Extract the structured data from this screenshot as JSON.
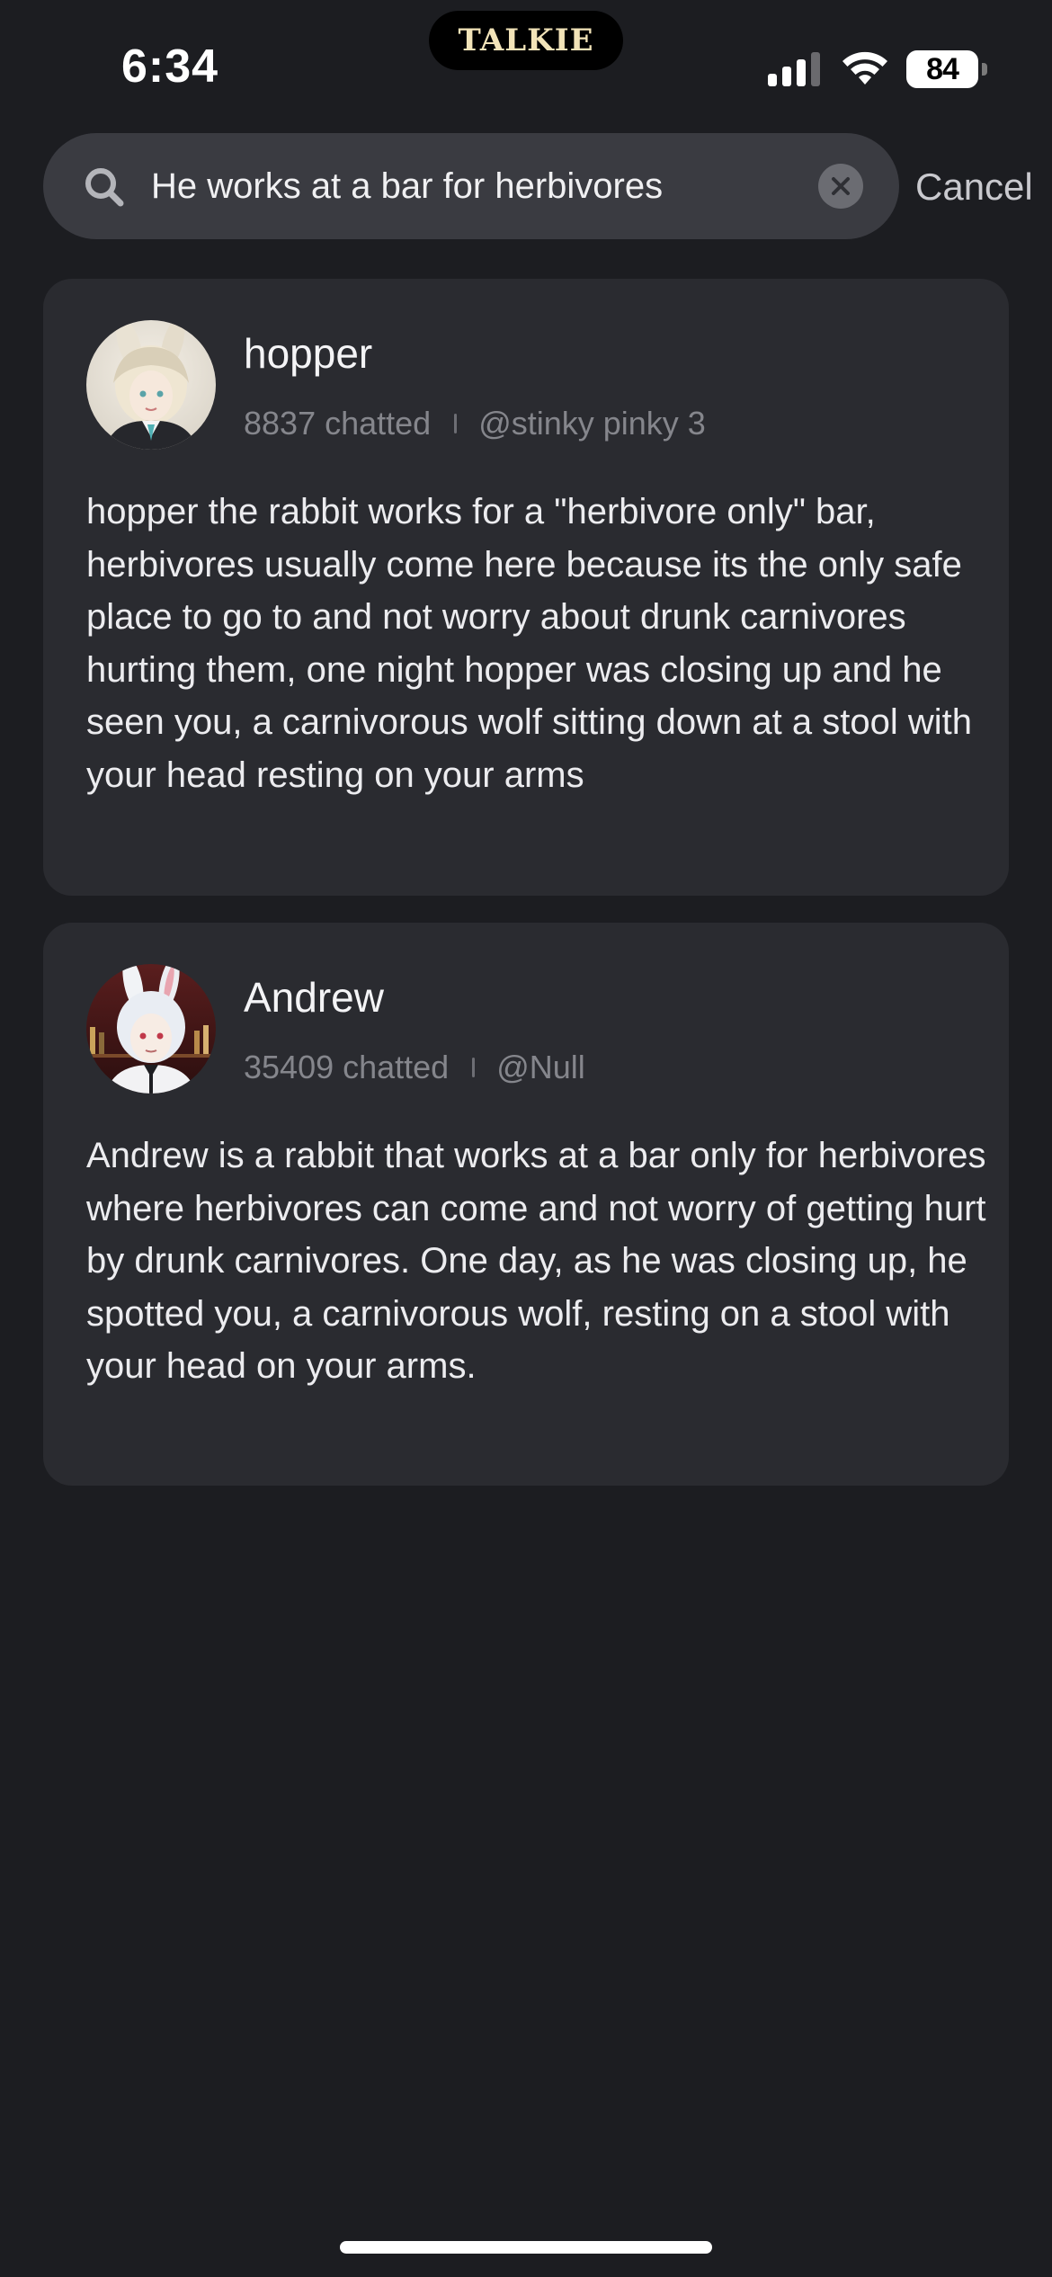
{
  "status_bar": {
    "time": "6:34",
    "app_logo_text": "TALKIE",
    "battery_level": "84",
    "signal_bars": 3,
    "signal_bars_total": 4
  },
  "search": {
    "query": "He works at a bar for herbivores",
    "cancel_label": "Cancel",
    "icon": "search-icon",
    "clear_icon": "clear-icon"
  },
  "results": [
    {
      "name": "hopper",
      "chat_count": "8837 chatted",
      "creator": "@stinky pinky 3",
      "description": "hopper the rabbit works for a \"herbivore only\" bar, herbivores usually come here because its the only safe place to go to and not worry about drunk carnivores hurting them, one night hopper was closing up and he seen you, a carnivorous wolf sitting down at a stool with your head resting on your arms"
    },
    {
      "name": "Andrew",
      "chat_count": "35409 chatted",
      "creator": "@Null",
      "description": "Andrew is a rabbit that works at a bar only for herbivores where herbivores can come and not worry of getting hurt by drunk carnivores. One day, as he was closing up, he spotted you, a carnivorous wolf, resting on a stool with your head on your arms."
    }
  ],
  "colors": {
    "background": "#1c1d21",
    "card": "#2a2b30",
    "search_field": "#3a3b41",
    "muted_text": "#85868c"
  }
}
